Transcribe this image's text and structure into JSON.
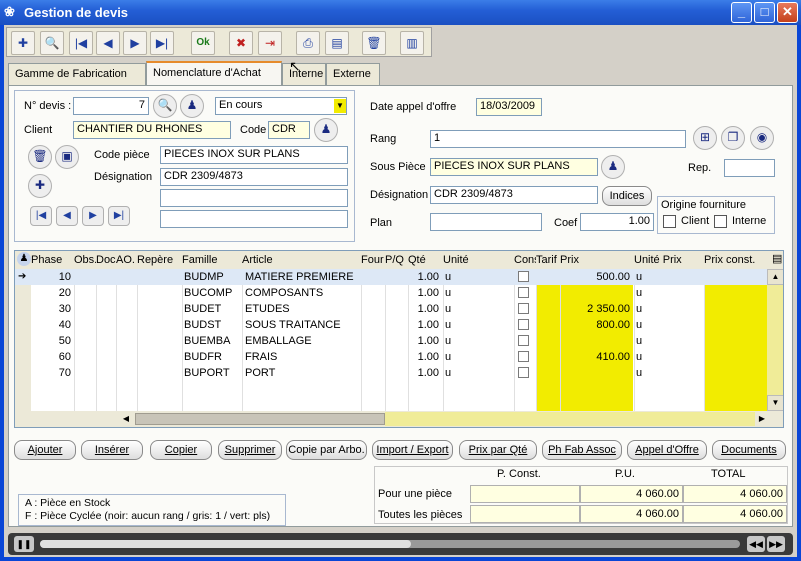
{
  "window": {
    "title": "Gestion de devis",
    "minimize": "_",
    "maximize": "□",
    "close": "✕"
  },
  "toolbar": [
    {
      "icon": "new-document-icon",
      "glyph": "✚"
    },
    {
      "icon": "search-tools-icon",
      "glyph": "🔍"
    },
    {
      "icon": "first-record-icon",
      "glyph": "|◀"
    },
    {
      "icon": "previous-record-icon",
      "glyph": "◀"
    },
    {
      "icon": "next-record-icon",
      "glyph": "▶"
    },
    {
      "icon": "last-record-icon",
      "glyph": "▶|"
    },
    {
      "icon": "ok-icon",
      "glyph": "Ok"
    },
    {
      "icon": "cancel-icon",
      "glyph": "✖"
    },
    {
      "icon": "exit-icon",
      "glyph": "⇥"
    },
    {
      "icon": "print-icon",
      "glyph": "⎙"
    },
    {
      "icon": "preview-icon",
      "glyph": "▤"
    },
    {
      "icon": "trash-icon",
      "glyph": "🗑"
    },
    {
      "icon": "books-icon",
      "glyph": "▥"
    }
  ],
  "tabs": [
    "Gamme de Fabrication",
    "Nomenclature d'Achat",
    "Interne",
    "Externe"
  ],
  "left_form": {
    "devis_label": "N° devis :",
    "devis_value": "7",
    "status": "En cours",
    "client_label": "Client",
    "client_value": "CHANTIER DU RHONES",
    "code_label": "Code",
    "code_value": "CDR",
    "code_piece_label": "Code pièce",
    "code_piece_value": "PIECES INOX SUR PLANS",
    "designation_label": "Désignation",
    "designation_value": "CDR 2309/4873",
    "dropdown_arrow": "▼",
    "nav_first": "|◀",
    "nav_prev": "◀",
    "nav_next": "▶",
    "nav_last": "▶|"
  },
  "right_form": {
    "date_label": "Date appel d'offre",
    "date_value": "18/03/2009",
    "rang_label": "Rang",
    "rang_value": "1",
    "sous_piece_label": "Sous Pièce",
    "sous_piece_value": "PIECES INOX SUR PLANS",
    "rep_label": "Rep.",
    "rep_value": "",
    "designation_label": "Désignation",
    "designation_value": "CDR 2309/4873",
    "indices_button": "Indices",
    "plan_label": "Plan",
    "plan_value": "",
    "coef_label": "Coef",
    "coef_value": "1.00",
    "origine_label": "Origine fourniture",
    "client_check": "Client",
    "interne_check": "Interne"
  },
  "grid": {
    "headers": [
      "Phase",
      "Obs.",
      "Doc",
      "AO.",
      "Repère",
      "Famille",
      "Article",
      "Four",
      "P/Q",
      "Qté",
      "Unité",
      "Const",
      "Tarif",
      "Prix",
      "Unité Prix",
      "Prix const."
    ],
    "rows": [
      {
        "phase": "10",
        "famille": "BUDMP",
        "article": "MATIERE PREMIERE",
        "qte": "1.00",
        "unite": "u",
        "prix": "500.00",
        "unite_prix": "u",
        "selected": true
      },
      {
        "phase": "20",
        "famille": "BUCOMP",
        "article": "COMPOSANTS",
        "qte": "1.00",
        "unite": "u",
        "prix": "",
        "unite_prix": "u"
      },
      {
        "phase": "30",
        "famille": "BUDET",
        "article": "ETUDES",
        "qte": "1.00",
        "unite": "u",
        "prix": "2 350.00",
        "unite_prix": "u"
      },
      {
        "phase": "40",
        "famille": "BUDST",
        "article": "SOUS TRAITANCE",
        "qte": "1.00",
        "unite": "u",
        "prix": "800.00",
        "unite_prix": "u"
      },
      {
        "phase": "50",
        "famille": "BUEMBA",
        "article": "EMBALLAGE",
        "qte": "1.00",
        "unite": "u",
        "prix": "",
        "unite_prix": "u"
      },
      {
        "phase": "60",
        "famille": "BUDFR",
        "article": "FRAIS",
        "qte": "1.00",
        "unite": "u",
        "prix": "410.00",
        "unite_prix": "u"
      },
      {
        "phase": "70",
        "famille": "BUPORT",
        "article": "PORT",
        "qte": "1.00",
        "unite": "u",
        "prix": "",
        "unite_prix": "u"
      }
    ]
  },
  "buttons": [
    "Ajouter",
    "Insérer",
    "Copier",
    "Supprimer",
    "Copie par Arbo.",
    "Import / Export",
    "Prix par Qté",
    "Ph Fab Assoc",
    "Appel d'Offre",
    "Documents"
  ],
  "legend": {
    "line1": "A : Pièce en Stock",
    "line2": "F : Pièce Cyclée (noir: aucun rang / gris: 1 / vert: pls)"
  },
  "totals": {
    "h_pconst": "P. Const.",
    "h_pu": "P.U.",
    "h_total": "TOTAL",
    "row1_label": "Pour une pièce",
    "row1_pconst": "",
    "row1_pu": "4 060.00",
    "row1_total": "4 060.00",
    "row2_label": "Toutes les pièces",
    "row2_pconst": "",
    "row2_pu": "4 060.00",
    "row2_total": "4 060.00"
  },
  "colors": {
    "title_blue": "#245fd6",
    "highlight_yellow": "#f2ec00",
    "selected_row": "#dde8f6"
  }
}
